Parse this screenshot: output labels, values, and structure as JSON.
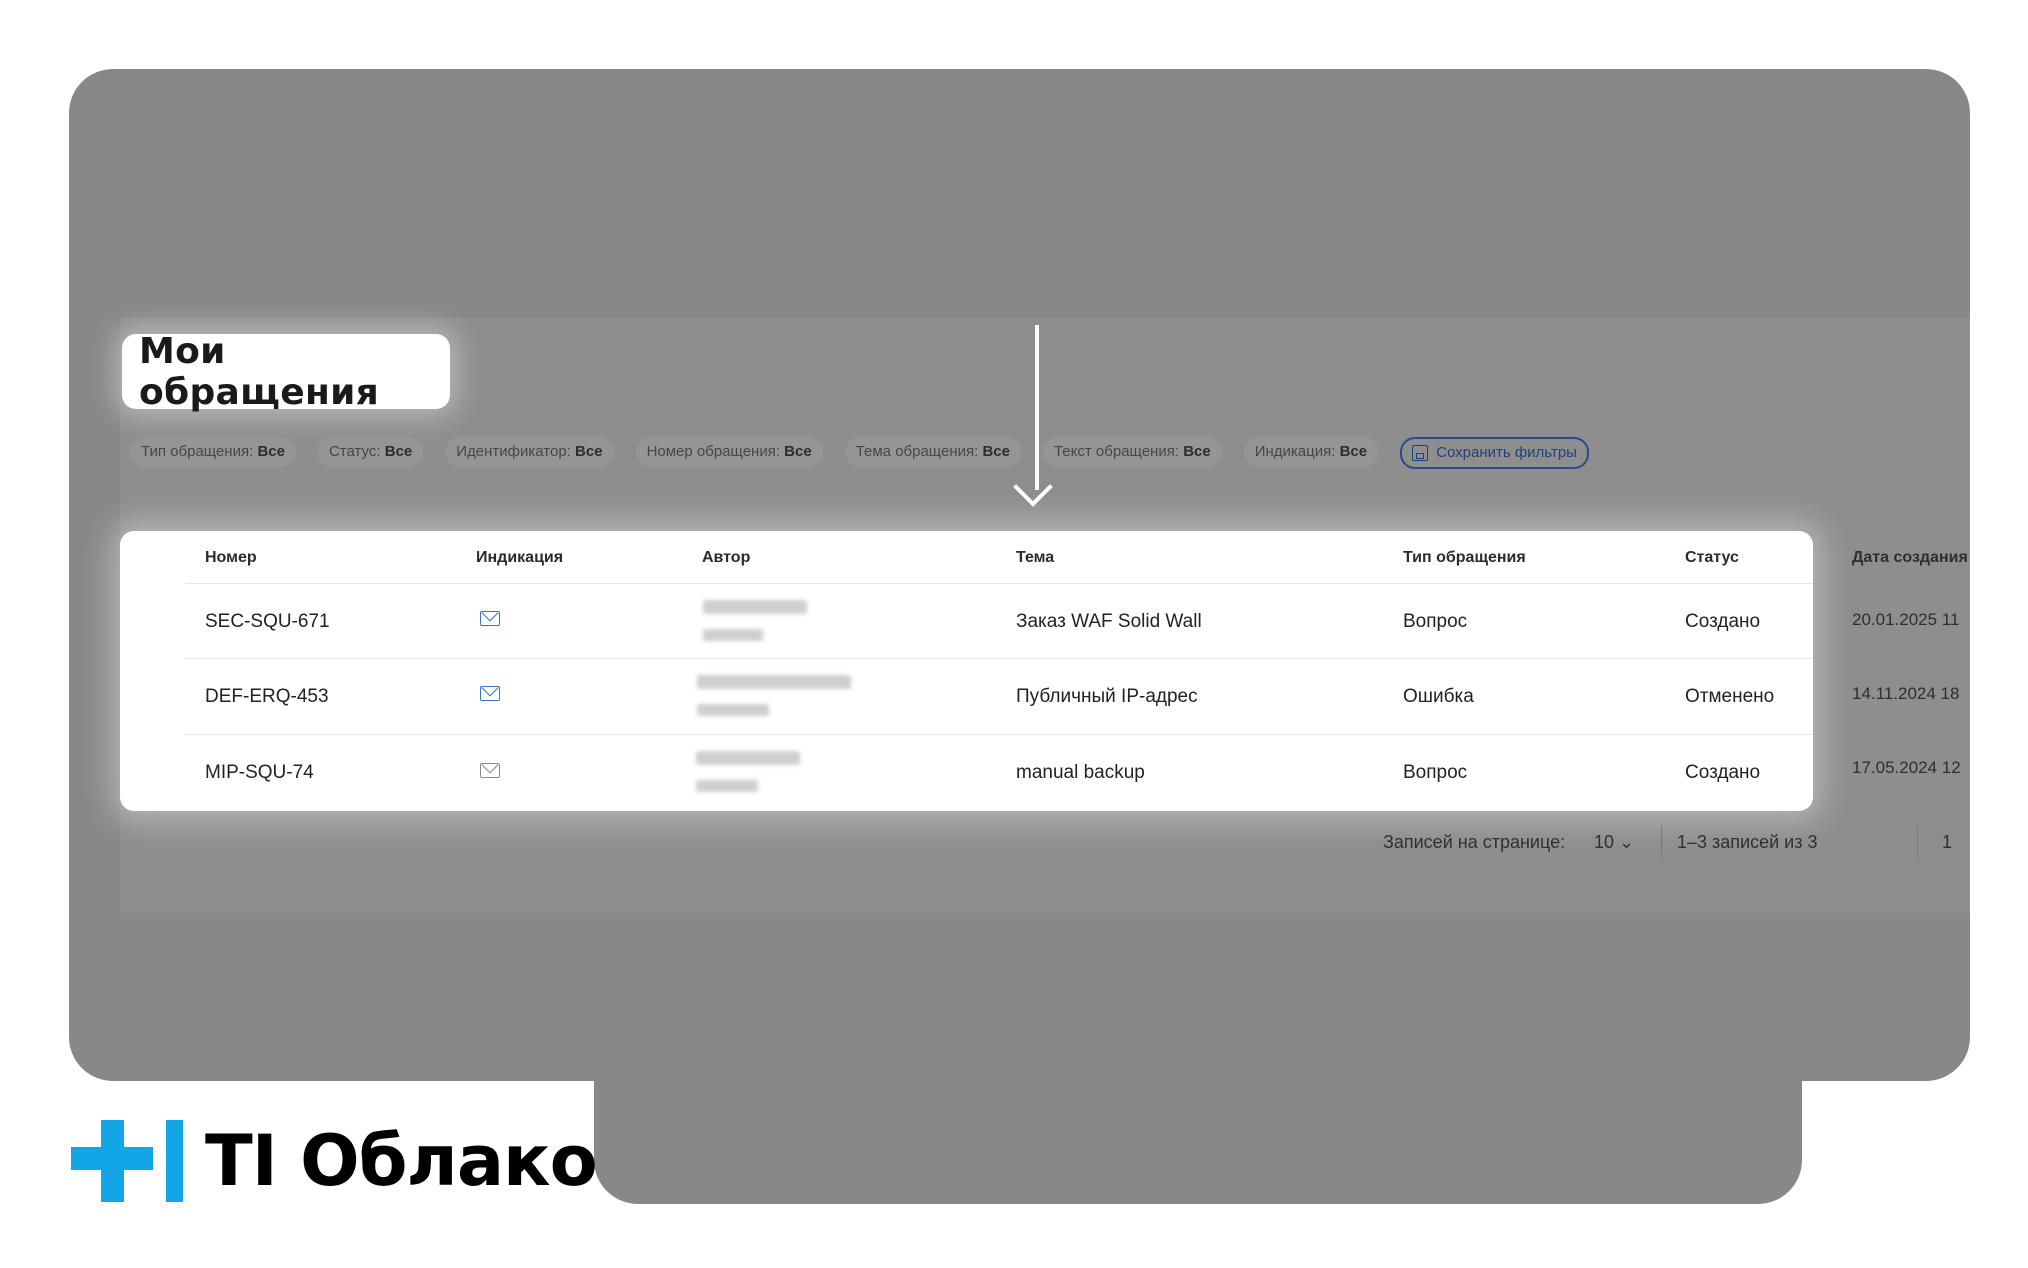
{
  "page": {
    "title": "Мои обращения"
  },
  "filters": [
    {
      "label": "Тип обращения:",
      "value": "Все"
    },
    {
      "label": "Статус:",
      "value": "Все"
    },
    {
      "label": "Идентификатор:",
      "value": "Все"
    },
    {
      "label": "Номер обращения:",
      "value": "Все"
    },
    {
      "label": "Тема обращения:",
      "value": "Все"
    },
    {
      "label": "Текст обращения:",
      "value": "Все"
    },
    {
      "label": "Индикация:",
      "value": "Все"
    }
  ],
  "save_filters_label": "Сохранить фильтры",
  "table": {
    "headers": [
      "Номер",
      "Индикация",
      "Автор",
      "Тема",
      "Тип обращения",
      "Статус",
      "Дата создания"
    ],
    "rows": [
      {
        "number": "SEC-SQU-671",
        "indication": "mail-unread-icon",
        "topic": "Заказ WAF Solid Wall",
        "type": "Вопрос",
        "status": "Создано",
        "created": "20.01.2025 11"
      },
      {
        "number": "DEF-ERQ-453",
        "indication": "mail-unread-icon",
        "topic": "Публичный IP-адрес",
        "type": "Ошибка",
        "status": "Отменено",
        "created": "14.11.2024 18"
      },
      {
        "number": "MIP-SQU-74",
        "indication": "mail-read-icon",
        "topic": "manual backup",
        "type": "Вопрос",
        "status": "Создано",
        "created": "17.05.2024 12"
      }
    ]
  },
  "pagination": {
    "per_page_label": "Записей на странице:",
    "per_page_value": "10",
    "range_label": "1–3 записей из 3",
    "page": "1"
  },
  "logo": {
    "text": "TI Облако",
    "accent": "#12a6e6"
  },
  "colors": {
    "backdrop": "#888888",
    "link": "#223f7a",
    "unread_icon": "#3a74c9"
  }
}
